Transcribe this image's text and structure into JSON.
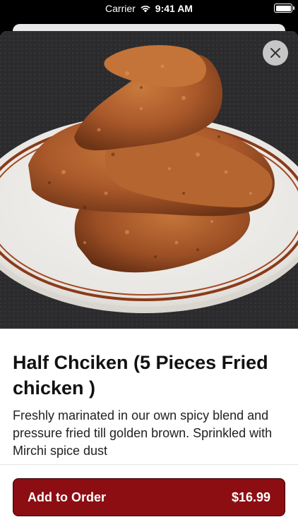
{
  "status_bar": {
    "carrier": "Carrier",
    "time": "9:41 AM"
  },
  "item": {
    "title": "Half Chciken (5 Pieces Fried chicken )",
    "description": "Freshly marinated in our own spicy blend and pressure fried till golden brown. Sprinkled with Mirchi spice dust",
    "image_subject": "fried chicken on a white plate with brown rim"
  },
  "actions": {
    "add_label": "Add to Order",
    "price": "$16.99"
  },
  "icons": {
    "close": "close-icon",
    "wifi": "wifi-icon",
    "battery": "battery-icon"
  },
  "colors": {
    "button_bg": "#8c0d12",
    "button_text": "#ffffff",
    "title_text": "#111111"
  }
}
